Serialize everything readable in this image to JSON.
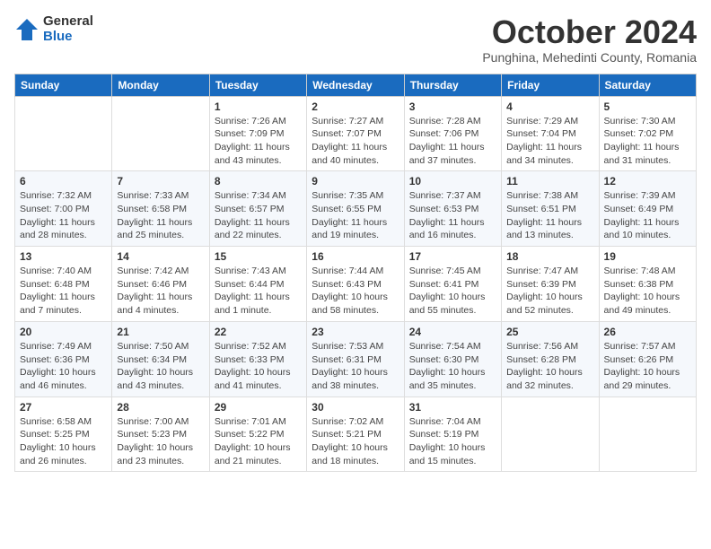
{
  "logo": {
    "general": "General",
    "blue": "Blue"
  },
  "title": "October 2024",
  "subtitle": "Punghina, Mehedinti County, Romania",
  "weekdays": [
    "Sunday",
    "Monday",
    "Tuesday",
    "Wednesday",
    "Thursday",
    "Friday",
    "Saturday"
  ],
  "weeks": [
    [
      {
        "day": "",
        "info": ""
      },
      {
        "day": "",
        "info": ""
      },
      {
        "day": "1",
        "info": "Sunrise: 7:26 AM\nSunset: 7:09 PM\nDaylight: 11 hours and 43 minutes."
      },
      {
        "day": "2",
        "info": "Sunrise: 7:27 AM\nSunset: 7:07 PM\nDaylight: 11 hours and 40 minutes."
      },
      {
        "day": "3",
        "info": "Sunrise: 7:28 AM\nSunset: 7:06 PM\nDaylight: 11 hours and 37 minutes."
      },
      {
        "day": "4",
        "info": "Sunrise: 7:29 AM\nSunset: 7:04 PM\nDaylight: 11 hours and 34 minutes."
      },
      {
        "day": "5",
        "info": "Sunrise: 7:30 AM\nSunset: 7:02 PM\nDaylight: 11 hours and 31 minutes."
      }
    ],
    [
      {
        "day": "6",
        "info": "Sunrise: 7:32 AM\nSunset: 7:00 PM\nDaylight: 11 hours and 28 minutes."
      },
      {
        "day": "7",
        "info": "Sunrise: 7:33 AM\nSunset: 6:58 PM\nDaylight: 11 hours and 25 minutes."
      },
      {
        "day": "8",
        "info": "Sunrise: 7:34 AM\nSunset: 6:57 PM\nDaylight: 11 hours and 22 minutes."
      },
      {
        "day": "9",
        "info": "Sunrise: 7:35 AM\nSunset: 6:55 PM\nDaylight: 11 hours and 19 minutes."
      },
      {
        "day": "10",
        "info": "Sunrise: 7:37 AM\nSunset: 6:53 PM\nDaylight: 11 hours and 16 minutes."
      },
      {
        "day": "11",
        "info": "Sunrise: 7:38 AM\nSunset: 6:51 PM\nDaylight: 11 hours and 13 minutes."
      },
      {
        "day": "12",
        "info": "Sunrise: 7:39 AM\nSunset: 6:49 PM\nDaylight: 11 hours and 10 minutes."
      }
    ],
    [
      {
        "day": "13",
        "info": "Sunrise: 7:40 AM\nSunset: 6:48 PM\nDaylight: 11 hours and 7 minutes."
      },
      {
        "day": "14",
        "info": "Sunrise: 7:42 AM\nSunset: 6:46 PM\nDaylight: 11 hours and 4 minutes."
      },
      {
        "day": "15",
        "info": "Sunrise: 7:43 AM\nSunset: 6:44 PM\nDaylight: 11 hours and 1 minute."
      },
      {
        "day": "16",
        "info": "Sunrise: 7:44 AM\nSunset: 6:43 PM\nDaylight: 10 hours and 58 minutes."
      },
      {
        "day": "17",
        "info": "Sunrise: 7:45 AM\nSunset: 6:41 PM\nDaylight: 10 hours and 55 minutes."
      },
      {
        "day": "18",
        "info": "Sunrise: 7:47 AM\nSunset: 6:39 PM\nDaylight: 10 hours and 52 minutes."
      },
      {
        "day": "19",
        "info": "Sunrise: 7:48 AM\nSunset: 6:38 PM\nDaylight: 10 hours and 49 minutes."
      }
    ],
    [
      {
        "day": "20",
        "info": "Sunrise: 7:49 AM\nSunset: 6:36 PM\nDaylight: 10 hours and 46 minutes."
      },
      {
        "day": "21",
        "info": "Sunrise: 7:50 AM\nSunset: 6:34 PM\nDaylight: 10 hours and 43 minutes."
      },
      {
        "day": "22",
        "info": "Sunrise: 7:52 AM\nSunset: 6:33 PM\nDaylight: 10 hours and 41 minutes."
      },
      {
        "day": "23",
        "info": "Sunrise: 7:53 AM\nSunset: 6:31 PM\nDaylight: 10 hours and 38 minutes."
      },
      {
        "day": "24",
        "info": "Sunrise: 7:54 AM\nSunset: 6:30 PM\nDaylight: 10 hours and 35 minutes."
      },
      {
        "day": "25",
        "info": "Sunrise: 7:56 AM\nSunset: 6:28 PM\nDaylight: 10 hours and 32 minutes."
      },
      {
        "day": "26",
        "info": "Sunrise: 7:57 AM\nSunset: 6:26 PM\nDaylight: 10 hours and 29 minutes."
      }
    ],
    [
      {
        "day": "27",
        "info": "Sunrise: 6:58 AM\nSunset: 5:25 PM\nDaylight: 10 hours and 26 minutes."
      },
      {
        "day": "28",
        "info": "Sunrise: 7:00 AM\nSunset: 5:23 PM\nDaylight: 10 hours and 23 minutes."
      },
      {
        "day": "29",
        "info": "Sunrise: 7:01 AM\nSunset: 5:22 PM\nDaylight: 10 hours and 21 minutes."
      },
      {
        "day": "30",
        "info": "Sunrise: 7:02 AM\nSunset: 5:21 PM\nDaylight: 10 hours and 18 minutes."
      },
      {
        "day": "31",
        "info": "Sunrise: 7:04 AM\nSunset: 5:19 PM\nDaylight: 10 hours and 15 minutes."
      },
      {
        "day": "",
        "info": ""
      },
      {
        "day": "",
        "info": ""
      }
    ]
  ]
}
